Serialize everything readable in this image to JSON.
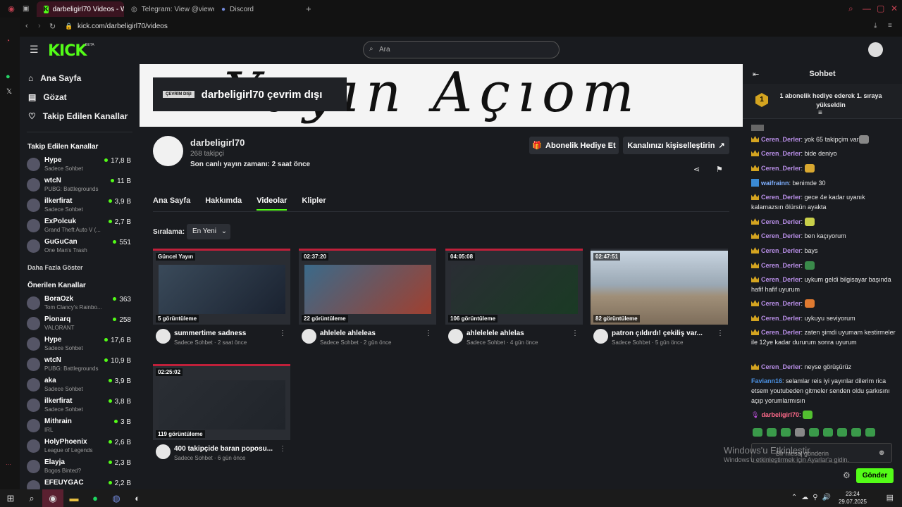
{
  "browser": {
    "tabs": [
      {
        "label": "darbeligirl70 Videos - Wat",
        "icon": "kick-icon"
      },
      {
        "label": "Telegram: View @viewer",
        "icon": "globe-icon"
      },
      {
        "label": "Discord",
        "icon": "discord-icon"
      }
    ],
    "url": "kick.com/darbeligirl70/videos"
  },
  "header": {
    "logo": "KICK",
    "beta": "BETA",
    "search_placeholder": "Ara"
  },
  "sidebar": {
    "nav": [
      {
        "label": "Ana Sayfa",
        "icon": "home-icon"
      },
      {
        "label": "Gözat",
        "icon": "browse-icon"
      },
      {
        "label": "Takip Edilen Kanallar",
        "icon": "heart-icon"
      }
    ],
    "followed_title": "Takip Edilen Kanallar",
    "followed": [
      {
        "name": "Hype",
        "category": "Sadece Sohbet",
        "viewers": "17,8 B"
      },
      {
        "name": "wtcN",
        "category": "PUBG: Battlegrounds",
        "viewers": "11 B"
      },
      {
        "name": "ilkerfirat",
        "category": "Sadece Sohbet",
        "viewers": "3,9 B"
      },
      {
        "name": "ExPolcuk",
        "category": "Grand Theft Auto V (...",
        "viewers": "2,7 B"
      },
      {
        "name": "GuGuCan",
        "category": "One Man's Trash",
        "viewers": "551"
      }
    ],
    "show_more": "Daha Fazla Göster",
    "recommended_title": "Önerilen Kanallar",
    "recommended": [
      {
        "name": "BoraOzk",
        "category": "Tom Clancy's Rainbo...",
        "viewers": "363"
      },
      {
        "name": "Pionarq",
        "category": "VALORANT",
        "viewers": "258"
      },
      {
        "name": "Hype",
        "category": "Sadece Sohbet",
        "viewers": "17,6 B"
      },
      {
        "name": "wtcN",
        "category": "PUBG: Battlegrounds",
        "viewers": "10,9 B"
      },
      {
        "name": "aka",
        "category": "Sadece Sohbet",
        "viewers": "3,9 B"
      },
      {
        "name": "ilkerfirat",
        "category": "Sadece Sohbet",
        "viewers": "3,8 B"
      },
      {
        "name": "Mithrain",
        "category": "IRL",
        "viewers": "3 B"
      },
      {
        "name": "HolyPhoenix",
        "category": "League of Legends",
        "viewers": "2,6 B"
      },
      {
        "name": "Elayja",
        "category": "Bogos Binted?",
        "viewers": "2,3 B"
      },
      {
        "name": "EFEUYGAC",
        "category": "",
        "viewers": "2,2 B"
      }
    ]
  },
  "channel": {
    "banner_text": "Yayın Açıom",
    "offline_badge": "ÇEVRİM DIŞI",
    "offline_text": "darbeligirl70 çevrim dışı",
    "name": "darbeligirl70",
    "followers": "268 takipçi",
    "last_live": "Son canlı yayın zamanı: 2 saat önce",
    "gift_button": "Abonelik Hediye Et",
    "customize_button": "Kanalınızı kişiselleştirin"
  },
  "tabs": [
    "Ana Sayfa",
    "Hakkımda",
    "Videolar",
    "Klipler"
  ],
  "sort": {
    "label": "Sıralama:",
    "value": "En Yeni"
  },
  "videos": [
    {
      "duration": "Güncel Yayın",
      "views": "5 görüntüleme",
      "title": "summertime sadness",
      "meta": "Sadece Sohbet · 2 saat önce"
    },
    {
      "duration": "02:37:20",
      "views": "22 görüntüleme",
      "title": "ahlelele ahleleas",
      "meta": "Sadece Sohbet · 2 gün önce"
    },
    {
      "duration": "04:05:08",
      "views": "106 görüntüleme",
      "title": "ahlelelele ahlelas",
      "meta": "Sadece Sohbet · 4 gün önce"
    },
    {
      "duration": "02:47:51",
      "views": "82 görüntüleme",
      "title": "patron çıldırdı! çekiliş var...",
      "meta": "Sadece Sohbet · 5 gün önce"
    },
    {
      "duration": "02:25:02",
      "views": "119 görüntüleme",
      "title": "400 takipçide baran poposu...",
      "meta": "Sadece Sohbet · 6 gün önce"
    }
  ],
  "chat": {
    "title": "Sohbet",
    "pinned_rank": "1",
    "pinned": "1 abonelik hediye ederek 1. sıraya yükseldin",
    "messages": [
      {
        "user": "Ceren_Derler",
        "text": "yok 65 takipçim var",
        "color": "#b98fe8"
      },
      {
        "user": "Ceren_Derler",
        "text": "bide deniyo",
        "color": "#b98fe8"
      },
      {
        "user": "Ceren_Derler",
        "text": "",
        "color": "#b98fe8"
      },
      {
        "user": "waifrainn",
        "text": "benimde 30",
        "color": "#7fb0ff"
      },
      {
        "user": "Ceren_Derler",
        "text": "gece 4e kadar uyanık kalamazsın ölürsün ayakta",
        "color": "#b98fe8"
      },
      {
        "user": "Ceren_Derler",
        "text": "",
        "color": "#b98fe8"
      },
      {
        "user": "Ceren_Derler",
        "text": "ben kaçıyorum",
        "color": "#b98fe8"
      },
      {
        "user": "Ceren_Derler",
        "text": "bays",
        "color": "#b98fe8"
      },
      {
        "user": "Ceren_Derler",
        "text": "",
        "color": "#b98fe8"
      },
      {
        "user": "Ceren_Derler",
        "text": "uykum geldi bilgisayar başında hafif hafif uyurum",
        "color": "#b98fe8"
      },
      {
        "user": "Ceren_Derler",
        "text": "",
        "color": "#b98fe8"
      },
      {
        "user": "Ceren_Derler",
        "text": "uykuyu seviyorum",
        "color": "#b98fe8"
      },
      {
        "user": "Ceren_Derler",
        "text": "zaten şimdi uyumam kestirmeler ile 12ye kadar dururum sonra uyurum",
        "color": "#b98fe8"
      },
      {
        "user": "Ceren_Derler",
        "text": "neyse görüşürüz",
        "color": "#b98fe8"
      },
      {
        "user": "Faviann16",
        "text": "selamlar reis iyi yayınlar dilerim rica etsem youtubeden gitmeler senden oldu şarkısını açıp yorumlarmısın",
        "color": "#4a90e2"
      },
      {
        "user": "darbeligirl70",
        "text": "",
        "color": "#ff6a8a"
      }
    ],
    "input_placeholder": "Bir mesaj gönderin",
    "send": "Gönder"
  },
  "os": {
    "watermark_title": "Windows'u Etkinleştir",
    "watermark_sub": "Windows'u etkinleştirmek için Ayarlar'a gidin.",
    "time": "23:24",
    "date": "29.07.2025"
  },
  "colors": {
    "accent": "#53fc18",
    "tab_active": "#3a1420"
  }
}
